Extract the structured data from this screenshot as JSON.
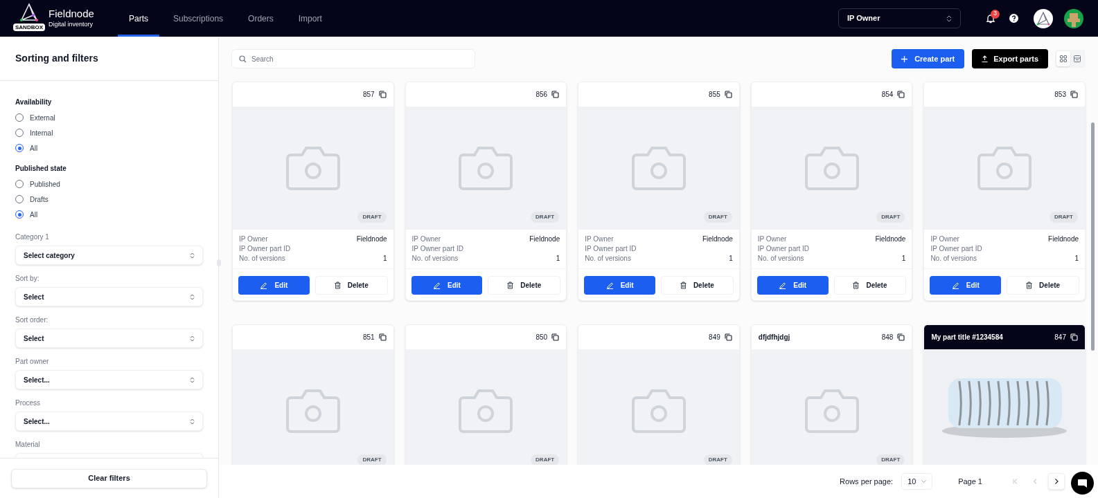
{
  "header": {
    "logo_badge": "SANDBOX",
    "app_name": "Fieldnode",
    "app_subtitle": "Digital inventory",
    "tabs": [
      {
        "label": "Parts",
        "selected": true
      },
      {
        "label": "Subscriptions",
        "selected": false
      },
      {
        "label": "Orders",
        "selected": false
      },
      {
        "label": "Import",
        "selected": false
      }
    ],
    "role_select": {
      "value": "IP Owner"
    },
    "notifications": {
      "count": "3"
    }
  },
  "sidebar": {
    "title": "Sorting and filters",
    "radio_groups": [
      {
        "title": "Availability",
        "options": [
          {
            "label": "External",
            "selected": false
          },
          {
            "label": "Internal",
            "selected": false
          },
          {
            "label": "All",
            "selected": true
          }
        ]
      },
      {
        "title": "Published state",
        "options": [
          {
            "label": "Published",
            "selected": false
          },
          {
            "label": "Drafts",
            "selected": false
          },
          {
            "label": "All",
            "selected": true
          }
        ]
      }
    ],
    "selects": [
      {
        "label": "Category 1",
        "value": "Select category"
      },
      {
        "label": "Sort by:",
        "value": "Select"
      },
      {
        "label": "Sort order:",
        "value": "Select"
      },
      {
        "label": "Part owner",
        "value": "Select..."
      },
      {
        "label": "Process",
        "value": "Select..."
      },
      {
        "label": "Material"
      }
    ],
    "clear_button": "Clear filters"
  },
  "toolbar": {
    "search": {
      "placeholder": "Search"
    },
    "create_button": "Create part",
    "export_button": "Export parts",
    "views": [
      {
        "kind": "grid",
        "selected": true
      },
      {
        "kind": "list",
        "selected": false
      }
    ]
  },
  "cards": [
    {
      "number": "857",
      "selected": false,
      "kind": "placeholder",
      "status": "DRAFT",
      "fields": [
        {
          "label": "IP Owner",
          "value": "Fieldnode"
        },
        {
          "label": "IP Owner part ID"
        },
        {
          "label": "No. of versions",
          "value": "1"
        }
      ],
      "actions": [
        "Edit",
        "Delete"
      ]
    },
    {
      "number": "856",
      "selected": false,
      "kind": "placeholder",
      "status": "DRAFT",
      "fields": [
        {
          "label": "IP Owner",
          "value": "Fieldnode"
        },
        {
          "label": "IP Owner part ID"
        },
        {
          "label": "No. of versions",
          "value": "1"
        }
      ],
      "actions": [
        "Edit",
        "Delete"
      ]
    },
    {
      "number": "855",
      "selected": false,
      "kind": "placeholder",
      "status": "DRAFT",
      "fields": [
        {
          "label": "IP Owner",
          "value": "Fieldnode"
        },
        {
          "label": "IP Owner part ID"
        },
        {
          "label": "No. of versions",
          "value": "1"
        }
      ],
      "actions": [
        "Edit",
        "Delete"
      ]
    },
    {
      "number": "854",
      "selected": false,
      "kind": "placeholder",
      "status": "DRAFT",
      "fields": [
        {
          "label": "IP Owner",
          "value": "Fieldnode"
        },
        {
          "label": "IP Owner part ID"
        },
        {
          "label": "No. of versions",
          "value": "1"
        }
      ],
      "actions": [
        "Edit",
        "Delete"
      ]
    },
    {
      "number": "853",
      "selected": false,
      "kind": "placeholder",
      "status": "DRAFT",
      "fields": [
        {
          "label": "IP Owner",
          "value": "Fieldnode"
        },
        {
          "label": "IP Owner part ID"
        },
        {
          "label": "No. of versions",
          "value": "1"
        }
      ],
      "actions": [
        "Edit",
        "Delete"
      ]
    },
    {
      "number": "851",
      "selected": false,
      "kind": "placeholder",
      "status": "DRAFT"
    },
    {
      "number": "850",
      "selected": false,
      "kind": "placeholder",
      "status": "DRAFT"
    },
    {
      "number": "849",
      "selected": false,
      "kind": "placeholder",
      "status": "DRAFT"
    },
    {
      "title": "dfjdfhjdgj",
      "number": "848",
      "selected": false,
      "kind": "placeholder",
      "status": "DRAFT"
    },
    {
      "title": "My part title #1234584",
      "number": "847",
      "selected": true,
      "kind": "picture"
    }
  ],
  "pagination": {
    "rows_label": "Rows per page:",
    "rows_value": "10",
    "page": "Page 1",
    "buttons": [
      {
        "kind": "first",
        "disabled": true
      },
      {
        "kind": "prev",
        "disabled": true
      },
      {
        "kind": "next",
        "disabled": false
      }
    ]
  }
}
